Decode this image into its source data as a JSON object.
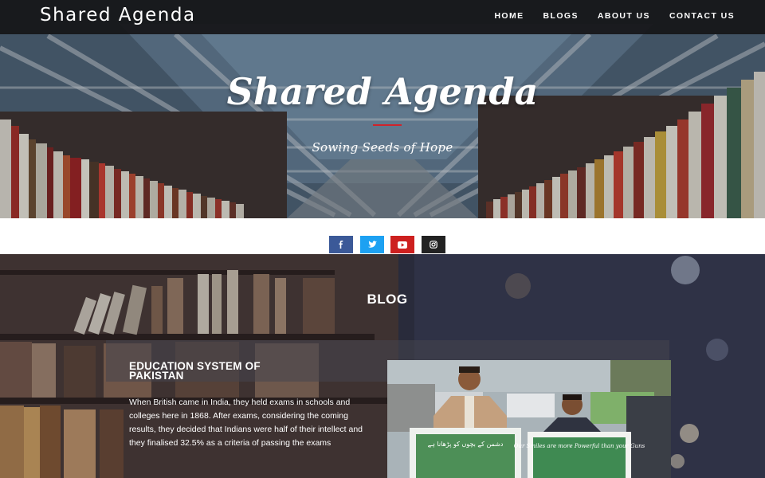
{
  "nav": {
    "brand": "Shared Agenda",
    "links": [
      {
        "label": "HOME"
      },
      {
        "label": "BLOGS"
      },
      {
        "label": "ABOUT US"
      },
      {
        "label": "CONTACT US"
      }
    ]
  },
  "hero": {
    "title": "Shared Agenda",
    "subtitle": "Sowing Seeds of Hope"
  },
  "social": [
    {
      "icon": "facebook-icon",
      "color": "#3b5998"
    },
    {
      "icon": "twitter-icon",
      "color": "#1da1f2"
    },
    {
      "icon": "youtube-icon",
      "color": "#cd201f"
    },
    {
      "icon": "instagram-icon",
      "color": "#222222"
    }
  ],
  "blog": {
    "heading": "BLOG",
    "post": {
      "title": "EDUCATION SYSTEM OF PAKISTAN",
      "excerpt": "When British came in India, they held exams in schools and colleges here in 1868. After exams, considering the coming results, they decided that Indians were half of their intellect and they finalised 32.5% as a criteria of passing the exams",
      "sign_left": "Our Smiles are more Powerful than your Guns"
    }
  },
  "colors": {
    "accent_rule": "#d0232a",
    "navbar_bg": "#161618"
  }
}
